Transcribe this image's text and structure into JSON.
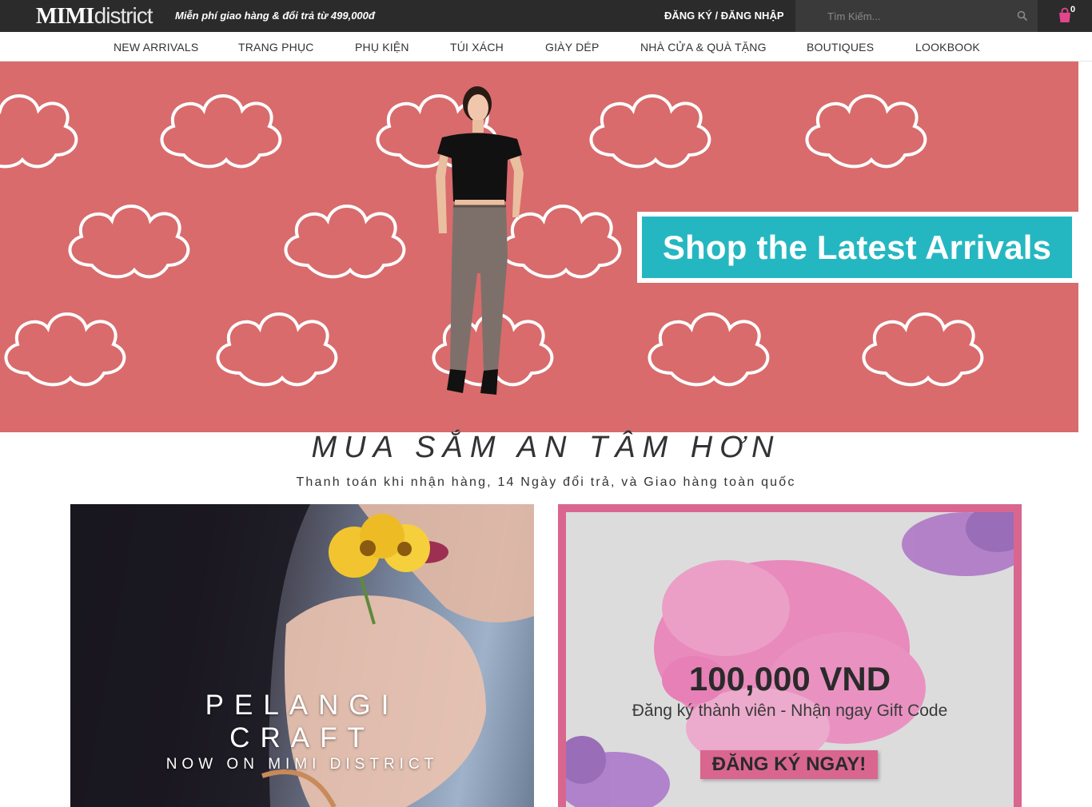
{
  "header": {
    "logo_bold": "MIMI",
    "logo_thin": "district",
    "promo_text": "Miễn phí giao hàng & đổi trả từ 499,000đ",
    "login_label": "ĐĂNG KÝ / ĐĂNG NHẬP",
    "search_placeholder": "Tìm Kiếm...",
    "search_icon": "search-icon",
    "cart_icon": "shopping-bag-icon",
    "cart_count": "0",
    "cart_icon_color": "#e0478a",
    "bar_color": "#2b2b2b"
  },
  "nav": {
    "items": [
      {
        "label": "NEW ARRIVALS"
      },
      {
        "label": "TRANG PHỤC"
      },
      {
        "label": "PHỤ KIỆN"
      },
      {
        "label": "TÚI XÁCH"
      },
      {
        "label": "GIÀY DÉP"
      },
      {
        "label": "NHÀ CỬA & QUÀ TẶNG"
      },
      {
        "label": "BOUTIQUES"
      },
      {
        "label": "LOOKBOOK"
      }
    ]
  },
  "hero": {
    "cta_label": "Shop the Latest Arrivals",
    "background_color": "#d96b6c",
    "cta_color": "#25b7c1"
  },
  "tagline": {
    "title": "MUA SẮM AN TÂM HƠN",
    "subtitle": "Thanh toán khi nhận hàng, 14 Ngày đổi trả, và Giao hàng toàn quốc"
  },
  "promo_left": {
    "title_line1": "PELANGI",
    "title_line2": "CRAFT",
    "subtitle": "NOW ON MIMI DISTRICT"
  },
  "promo_right": {
    "amount": "100,000 VND",
    "text": "Đăng ký thành viên - Nhận ngay Gift Code",
    "button_label": "ĐĂNG KÝ NGAY!",
    "accent_color": "#d9668f"
  }
}
